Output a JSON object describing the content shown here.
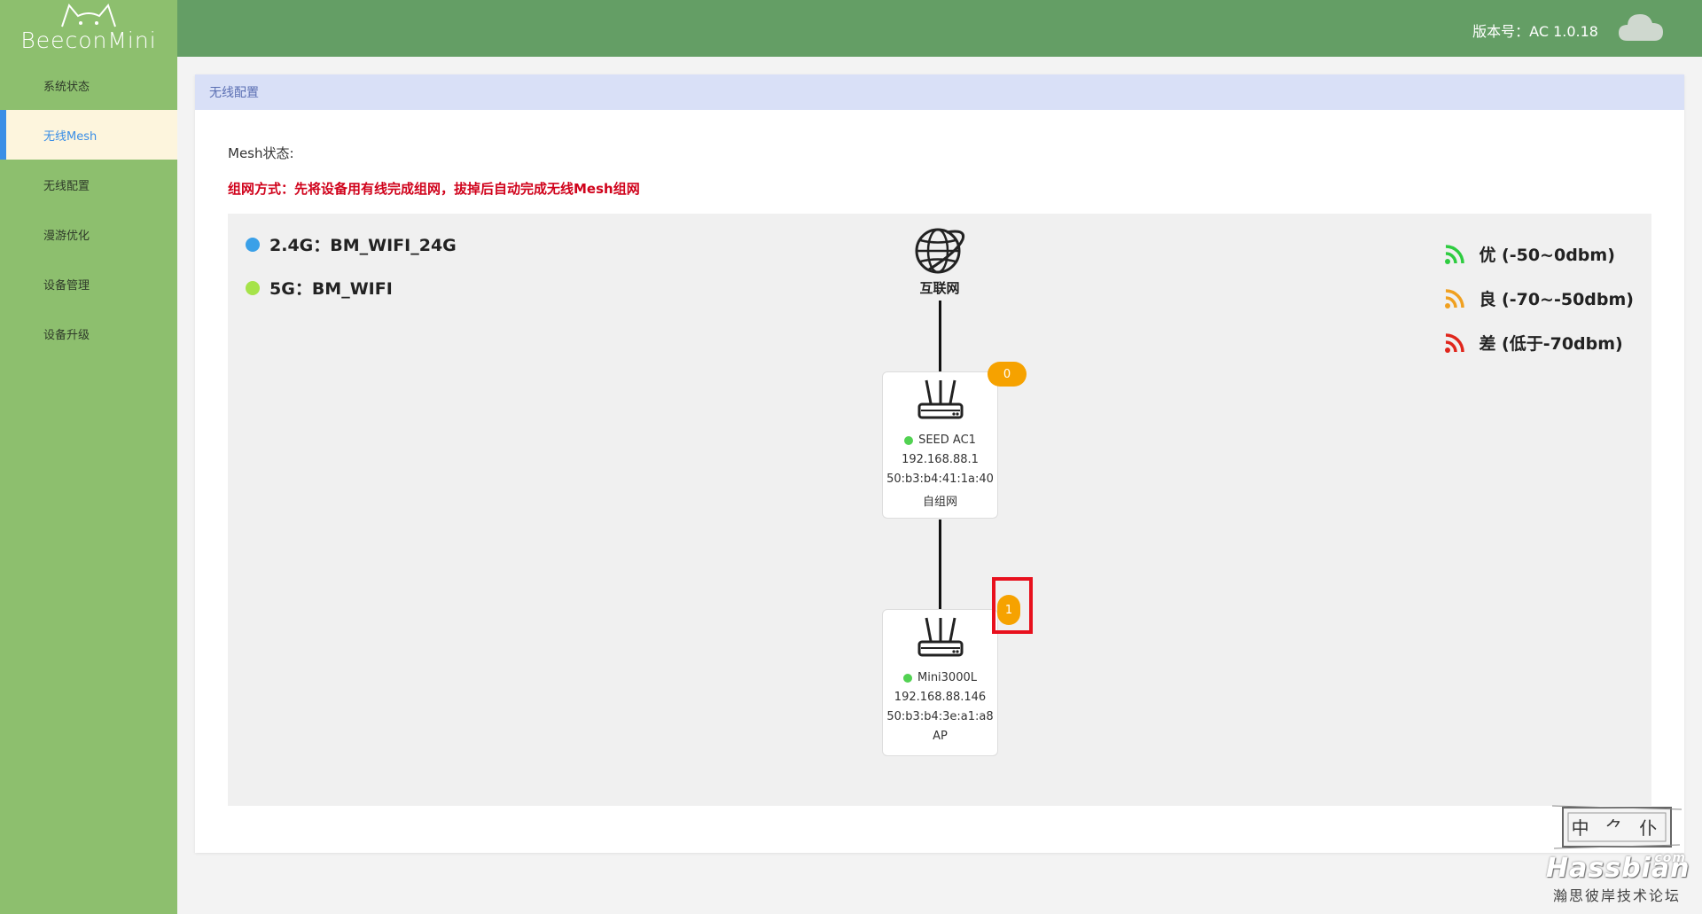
{
  "sidebar": {
    "logo_text": "BeeconMini",
    "items": [
      {
        "label": "系统状态",
        "active": false
      },
      {
        "label": "无线Mesh",
        "active": true
      },
      {
        "label": "无线配置",
        "active": false
      },
      {
        "label": "漫游优化",
        "active": false
      },
      {
        "label": "设备管理",
        "active": false
      },
      {
        "label": "设备升级",
        "active": false
      }
    ]
  },
  "header": {
    "version": "版本号：AC 1.0.18",
    "cloud_icon": "cloud-icon"
  },
  "card": {
    "title": "无线配置",
    "mesh_status_label": "Mesh状态:",
    "note": "组网方式：先将设备用有线完成组网，拔掉后自动完成无线Mesh组网"
  },
  "topology": {
    "ssids": [
      {
        "label": "2.4G：BM_WIFI_24G",
        "color": "#3aa0e8"
      },
      {
        "label": "5G：BM_WIFI",
        "color": "#a6e34a"
      }
    ],
    "legend": [
      {
        "label": "优 (-50~0dbm)",
        "color": "#2ecc40"
      },
      {
        "label": "良 (-70~-50dbm)",
        "color": "#f0a020"
      },
      {
        "label": "差 (低于-70dbm)",
        "color": "#e0261c"
      }
    ],
    "internet_label": "互联网",
    "nodes": [
      {
        "name": "SEED AC1",
        "ip": "192.168.88.1",
        "mac": "50:b3:b4:41:1a:40",
        "mode": "自组网",
        "badge": "0"
      },
      {
        "name": "Mini3000L",
        "ip": "192.168.88.146",
        "mac": "50:b3:b4:3e:a1:a8",
        "mode": "AP",
        "badge": "1"
      }
    ]
  },
  "watermark": {
    "seal_text": "中 ⺈ 仆",
    "brand": "Hassbian",
    "com": "com",
    "subtitle": "瀚思彼岸技术论坛"
  }
}
